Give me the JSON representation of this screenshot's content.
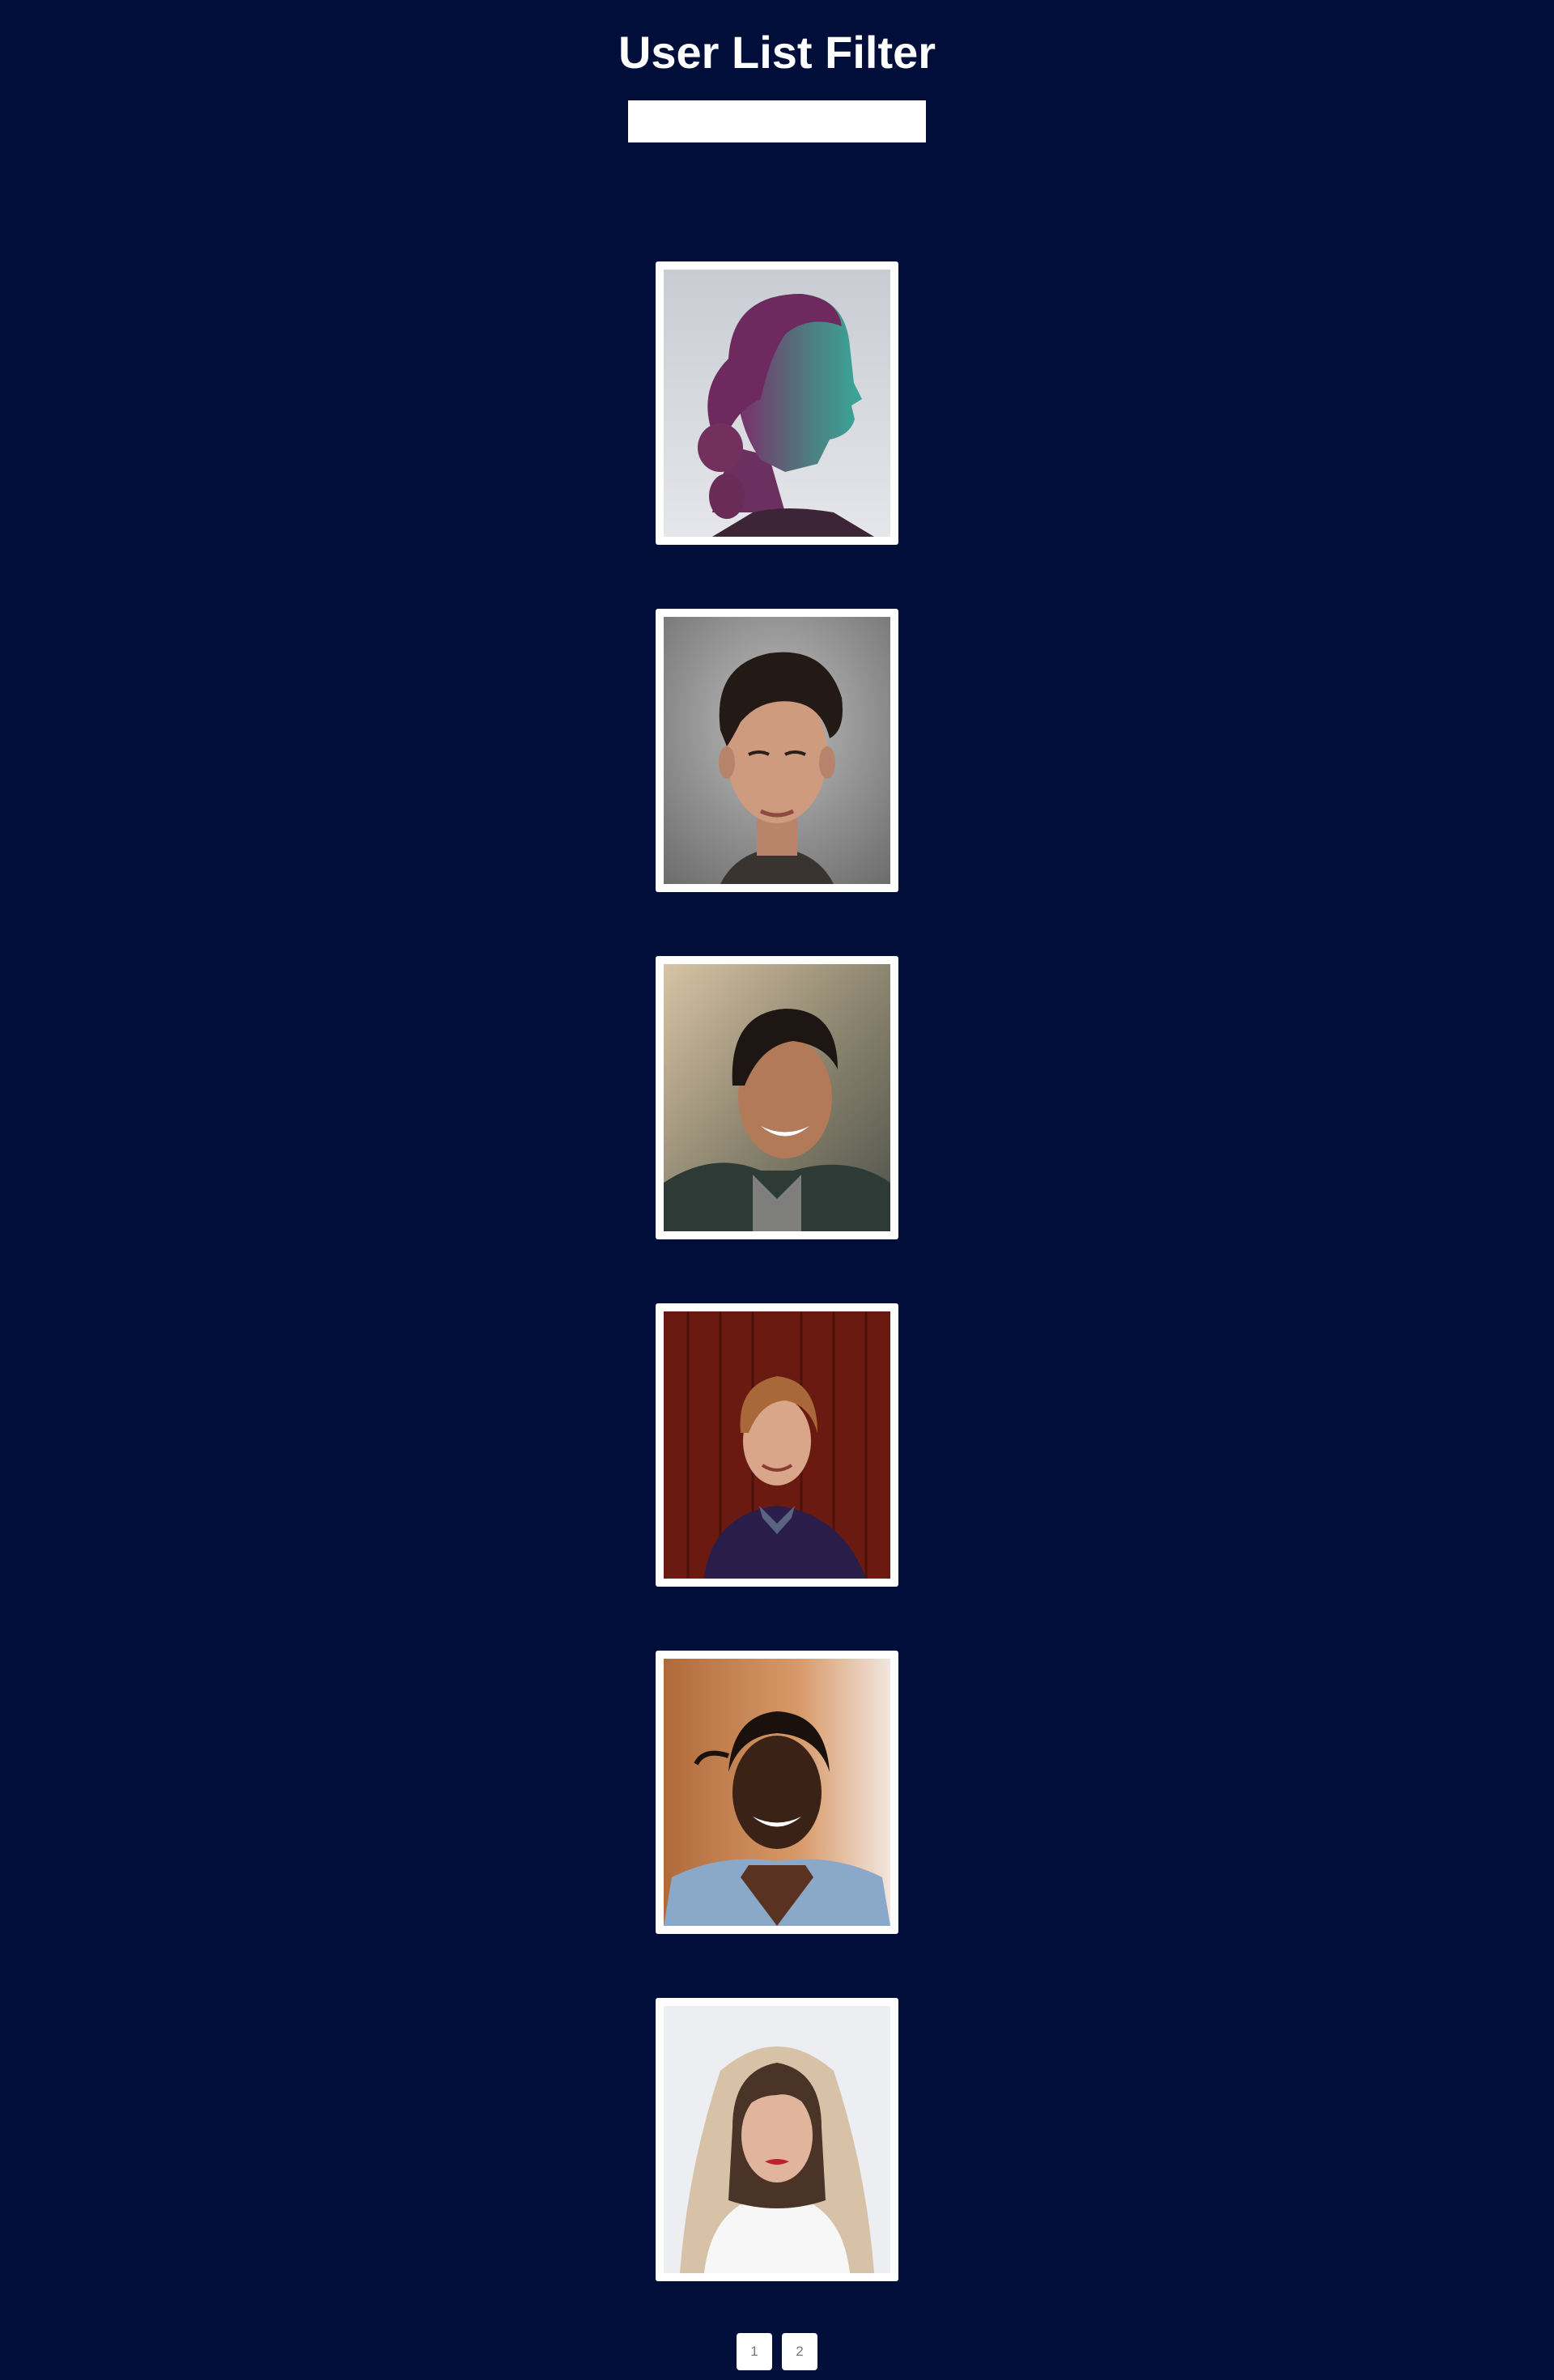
{
  "header": {
    "title": "User List Filter"
  },
  "search": {
    "value": "",
    "placeholder": ""
  },
  "users": [
    {
      "avatar": "woman-profile-teal-magenta-light"
    },
    {
      "avatar": "young-man-portrait-gray-background"
    },
    {
      "avatar": "smiling-man-outdoors-jacket"
    },
    {
      "avatar": "smiling-man-red-wood-wall"
    },
    {
      "avatar": "smiling-man-headphones-street"
    },
    {
      "avatar": "woman-white-hood-snow"
    }
  ],
  "pagination": {
    "pages": [
      "1",
      "2"
    ]
  }
}
